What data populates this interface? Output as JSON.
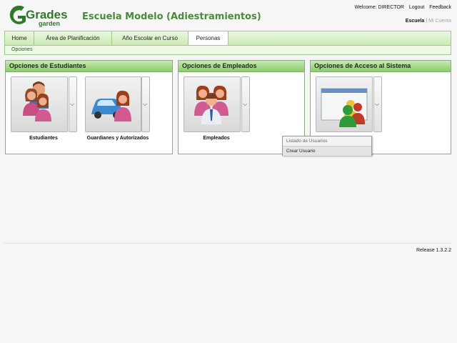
{
  "header": {
    "logo_text_main": "Grades",
    "logo_text_sub": "garden",
    "school_title": "Escuela Modelo (Adiestramientos)",
    "welcome": "Welcome: DIRECTOR",
    "logout": "Logout",
    "feedback": "Feedback",
    "role_current": "Escuela",
    "role_separator": "|",
    "role_other": "Mi Cuenta"
  },
  "nav": {
    "tabs": [
      {
        "label": "Home"
      },
      {
        "label": "Área de Planificación"
      },
      {
        "label": "Año Escolar en Curso"
      },
      {
        "label": "Personas"
      }
    ],
    "active_tab": "Personas",
    "sub_label": "Opciones"
  },
  "panels": [
    {
      "title": "Opciones de Estudiantes",
      "items": [
        {
          "label": "Estudiantes"
        },
        {
          "label": "Guardianes y Autorizados"
        }
      ]
    },
    {
      "title": "Opciones de Empleados",
      "items": [
        {
          "label": "Empleados"
        }
      ]
    },
    {
      "title": "Opciones de Acceso al Sistema",
      "items": [
        {
          "label": ""
        }
      ]
    }
  ],
  "dropdown_menu": {
    "items": [
      {
        "label": "Listado de Usuarios"
      },
      {
        "label": "Crear Usuario"
      }
    ]
  },
  "footer": {
    "release": "Release 1.3.2.2"
  },
  "colors": {
    "brand_green": "#4a8a3a",
    "header_green": "#8ccb6e"
  },
  "icons": [
    "chevron-down-icon",
    "people-icon",
    "car-icon",
    "window-icon"
  ]
}
